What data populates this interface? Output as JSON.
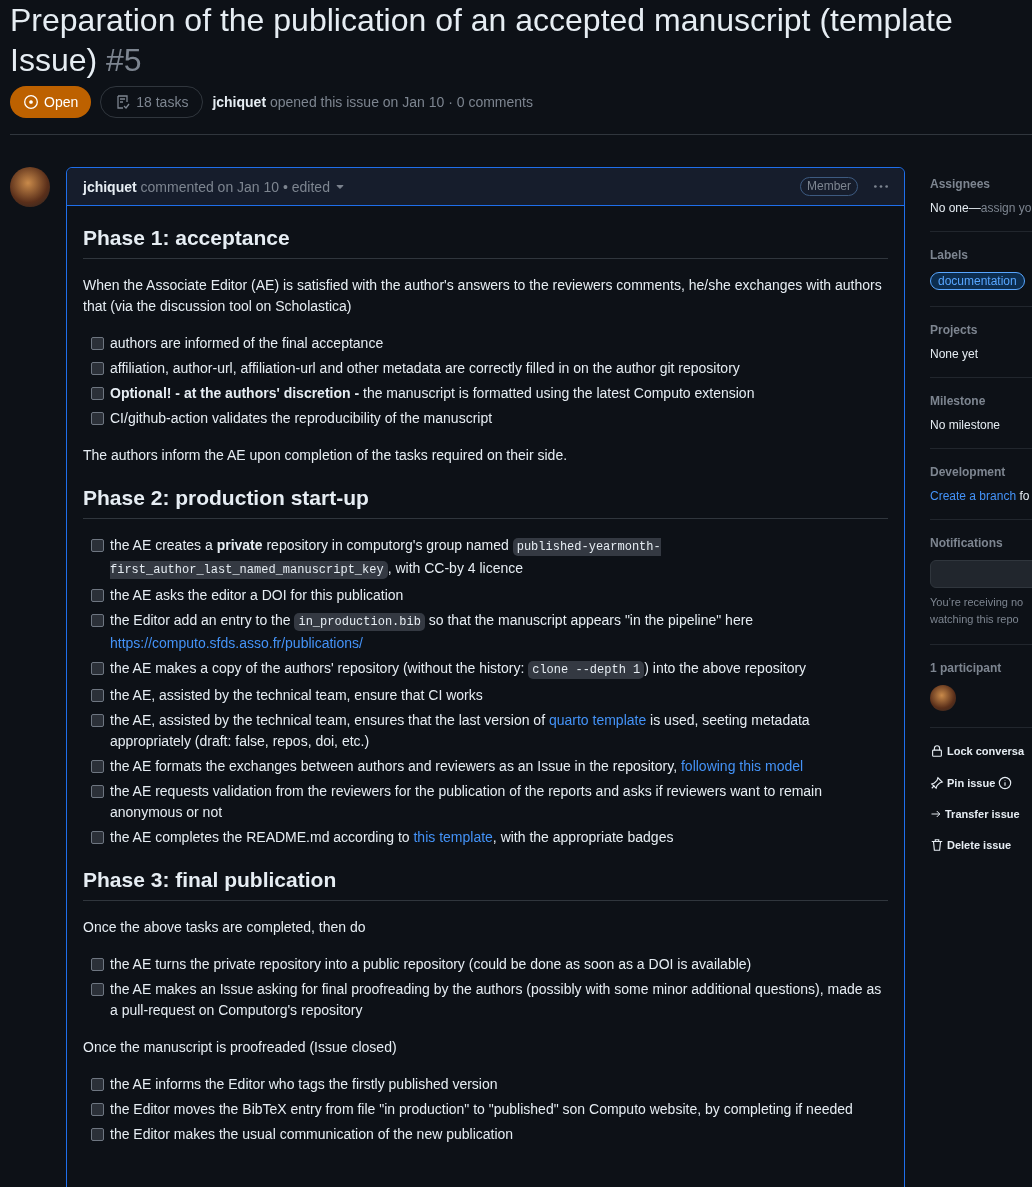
{
  "issue": {
    "title": "Preparation of the publication of an accepted manuscript (template Issue)",
    "number": "#5",
    "state": {
      "label": "Open",
      "kind": "open"
    },
    "tasks_badge": "18 tasks",
    "author": "jchiquet",
    "meta": "opened this issue on Jan 10 · 0 comments"
  },
  "comment": {
    "author": "jchiquet",
    "meta": "commented on Jan 10 • edited",
    "role": "Member",
    "sections": [
      {
        "heading": "Phase 1: acceptance",
        "blocks": [
          {
            "kind": "paragraph",
            "text": "When the Associate Editor (AE) is satisfied with the author's answers to the reviewers comments, he/she exchanges with authors that (via the discussion tool on Scholastica)"
          },
          {
            "kind": "tasks",
            "items": [
              {
                "checked": false,
                "parts": [
                  {
                    "kind": "text",
                    "text": "authors are informed of the final acceptance"
                  }
                ]
              },
              {
                "checked": false,
                "parts": [
                  {
                    "kind": "text",
                    "text": "affiliation, author-url, affiliation-url and other metadata are correctly filled in on the author git repository"
                  }
                ]
              },
              {
                "checked": false,
                "parts": [
                  {
                    "kind": "text",
                    "text": "**Optional! - at the authors' discretion -** the manuscript is formatted using the latest Computo extension"
                  }
                ]
              },
              {
                "checked": false,
                "parts": [
                  {
                    "kind": "text",
                    "text": "CI/github-action validates the reproducibility of the manuscript"
                  }
                ]
              }
            ]
          },
          {
            "kind": "paragraph",
            "text": "The authors inform the AE upon completion of the tasks required on their side."
          }
        ]
      },
      {
        "heading": "Phase 2: production start-up",
        "blocks": [
          {
            "kind": "tasks",
            "items": [
              {
                "checked": false,
                "parts": [
                  {
                    "kind": "text",
                    "text": "the AE creates a **private** repository in computorg's group named "
                  },
                  {
                    "kind": "code",
                    "text": "published-yearmonth-first_author_last_named_manuscript_key"
                  },
                  {
                    "kind": "text",
                    "text": ", with CC-by 4 licence"
                  }
                ]
              },
              {
                "checked": false,
                "parts": [
                  {
                    "kind": "text",
                    "text": "the AE asks the editor a DOI for this publication"
                  }
                ]
              },
              {
                "checked": false,
                "parts": [
                  {
                    "kind": "text",
                    "text": "the Editor add an entry to the "
                  },
                  {
                    "kind": "code",
                    "text": "in_production.bib"
                  },
                  {
                    "kind": "text",
                    "text": " so that the manuscript appears \"in the pipeline\" here "
                  },
                  {
                    "kind": "link",
                    "text": "https://computo.sfds.asso.fr/publications/"
                  }
                ]
              },
              {
                "checked": false,
                "parts": [
                  {
                    "kind": "text",
                    "text": "the AE makes a copy of the authors' repository (without the history: "
                  },
                  {
                    "kind": "code",
                    "text": "clone --depth 1"
                  },
                  {
                    "kind": "text",
                    "text": ") into the above repository"
                  }
                ]
              },
              {
                "checked": false,
                "parts": [
                  {
                    "kind": "text",
                    "text": "the AE, assisted by the technical team, ensure that CI works"
                  }
                ]
              },
              {
                "checked": false,
                "parts": [
                  {
                    "kind": "text",
                    "text": "the AE, assisted by the technical team, ensures that the last version of "
                  },
                  {
                    "kind": "link",
                    "text": "quarto template"
                  },
                  {
                    "kind": "text",
                    "text": " is used, seeting metadata appropriately (draft: false, repos, doi, etc.)"
                  }
                ]
              },
              {
                "checked": false,
                "parts": [
                  {
                    "kind": "text",
                    "text": "the AE formats the exchanges between authors and reviewers as an Issue in the repository, "
                  },
                  {
                    "kind": "link",
                    "text": "following this model"
                  }
                ]
              },
              {
                "checked": false,
                "parts": [
                  {
                    "kind": "text",
                    "text": "the AE requests validation from the reviewers for the publication of the reports and asks if reviewers want to remain anonymous or not"
                  }
                ]
              },
              {
                "checked": false,
                "parts": [
                  {
                    "kind": "text",
                    "text": "the AE completes the README.md according to "
                  },
                  {
                    "kind": "link",
                    "text": "this template"
                  },
                  {
                    "kind": "text",
                    "text": ", with the appropriate badges"
                  }
                ]
              }
            ]
          }
        ]
      },
      {
        "heading": "Phase 3: final publication",
        "blocks": [
          {
            "kind": "paragraph",
            "text": "Once the above tasks are completed, then do"
          },
          {
            "kind": "tasks",
            "items": [
              {
                "checked": false,
                "parts": [
                  {
                    "kind": "text",
                    "text": "the AE turns the private repository into a public repository (could be done as soon as a DOI is available)"
                  }
                ]
              },
              {
                "checked": false,
                "parts": [
                  {
                    "kind": "text",
                    "text": "the AE makes an Issue asking for final proofreading by the authors (possibly with some minor additional questions), made as a pull-request on Computorg's repository"
                  }
                ]
              }
            ]
          },
          {
            "kind": "paragraph",
            "text": "Once the manuscript is proofreaded (Issue closed)"
          },
          {
            "kind": "tasks",
            "items": [
              {
                "checked": false,
                "parts": [
                  {
                    "kind": "text",
                    "text": "the AE informs the Editor who tags the firstly published version"
                  }
                ]
              },
              {
                "checked": false,
                "parts": [
                  {
                    "kind": "text",
                    "text": "the Editor moves the BibTeX entry from file \"in production\" to \"published\" son Computo website, by completing if needed"
                  }
                ]
              },
              {
                "checked": false,
                "parts": [
                  {
                    "kind": "text",
                    "text": "the Editor makes the usual communication of the new publication"
                  }
                ]
              }
            ]
          }
        ]
      }
    ]
  },
  "sidebar": {
    "sections": [
      {
        "title": "Assignees",
        "kind": "assignees",
        "value": "No one—",
        "link": "assign yo"
      },
      {
        "title": "Labels",
        "kind": "labels",
        "labels": [
          {
            "name": "documentation",
            "color": "#58a6ff"
          }
        ]
      },
      {
        "title": "Projects",
        "kind": "text",
        "value": "None yet"
      },
      {
        "title": "Milestone",
        "kind": "text",
        "value": "No milestone"
      },
      {
        "title": "Development",
        "kind": "development",
        "link": "Create a branch",
        "value": " fo"
      },
      {
        "title": "Notifications",
        "kind": "notifications",
        "lines": [
          "You’re receiving no",
          "watching this repo"
        ]
      },
      {
        "title": "1 participant",
        "kind": "participants"
      }
    ],
    "actions": [
      {
        "kind": "lock",
        "label": "Lock conversa"
      },
      {
        "kind": "pin",
        "label": "Pin issue"
      },
      {
        "kind": "transfer",
        "label": "Transfer issue"
      },
      {
        "kind": "delete",
        "label": "Delete issue"
      }
    ]
  }
}
